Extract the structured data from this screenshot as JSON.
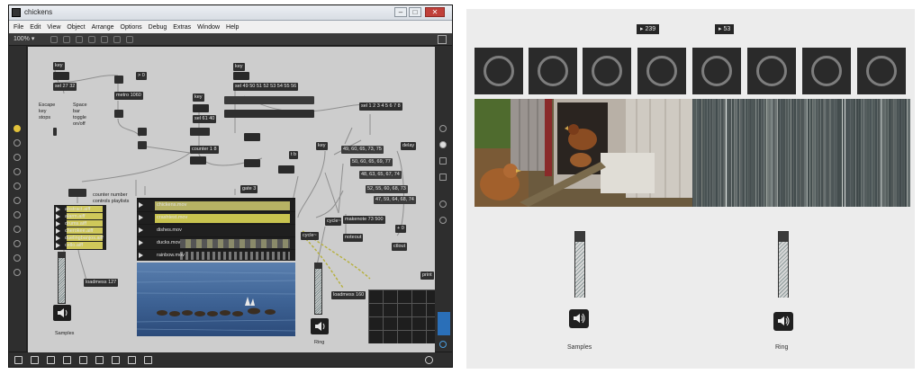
{
  "window": {
    "title": "chickens",
    "menu": [
      "File",
      "Edit",
      "View",
      "Object",
      "Arrange",
      "Options",
      "Debug",
      "Extras",
      "Window",
      "Help"
    ],
    "zoom": "100% ▾"
  },
  "patcher": {
    "objects": {
      "key1": "key",
      "sel27_32": "sel 27 32",
      "metro": "metro 1060",
      "gt0": "> 0",
      "sel49": "sel 49 50 51 52 53 54 55 56",
      "key2": "key",
      "sel61": "sel 61 40",
      "counter": "counter 1 8",
      "key3": "key",
      "tobuf": "t b",
      "sel12": "sel 1 2 3 4 5 6 7 8",
      "m1": "49, 60, 65, 73, 75",
      "m2": "50, 60, 65, 69, 77",
      "m3": "48, 63, 65, 67, 74",
      "m4": "52, 55, 60, 68, 73",
      "m5": "47, 59, 64, 68, 74",
      "delay": "delay",
      "makenote": "makenote 73 500",
      "noteout": "noteout",
      "ctlout": "ctlout",
      "cycle": "cycle~",
      "gate3": "gate 3",
      "loadmess1": "loadmess 127",
      "loadmess2": "loadmess 160",
      "print": "print",
      "plusx": "+ 0"
    },
    "comments": {
      "escape": "Escape key stops",
      "space": "Space bar toggle on/off",
      "counter_note": "counter number controls playlists",
      "samples": "Samples",
      "ring": "Ring"
    },
    "playlist_small": [
      "abstract.aiff",
      "alarm.aiff",
      "drums.aiff",
      "cherokee.aiff",
      "duelingbanjos.aiff",
      "cello.aiff"
    ],
    "playlist_video": [
      "chickens.mov",
      "crashtest.mov",
      "dishes.mov",
      "ducks.mov",
      "rainbow.mov"
    ]
  },
  "presentation": {
    "badge1": "239",
    "badge2": "53",
    "dial_count": 8,
    "meter_left_level": 0.85,
    "meter_right_level": 0.85,
    "label_left": "Samples",
    "label_right": "Ring"
  }
}
